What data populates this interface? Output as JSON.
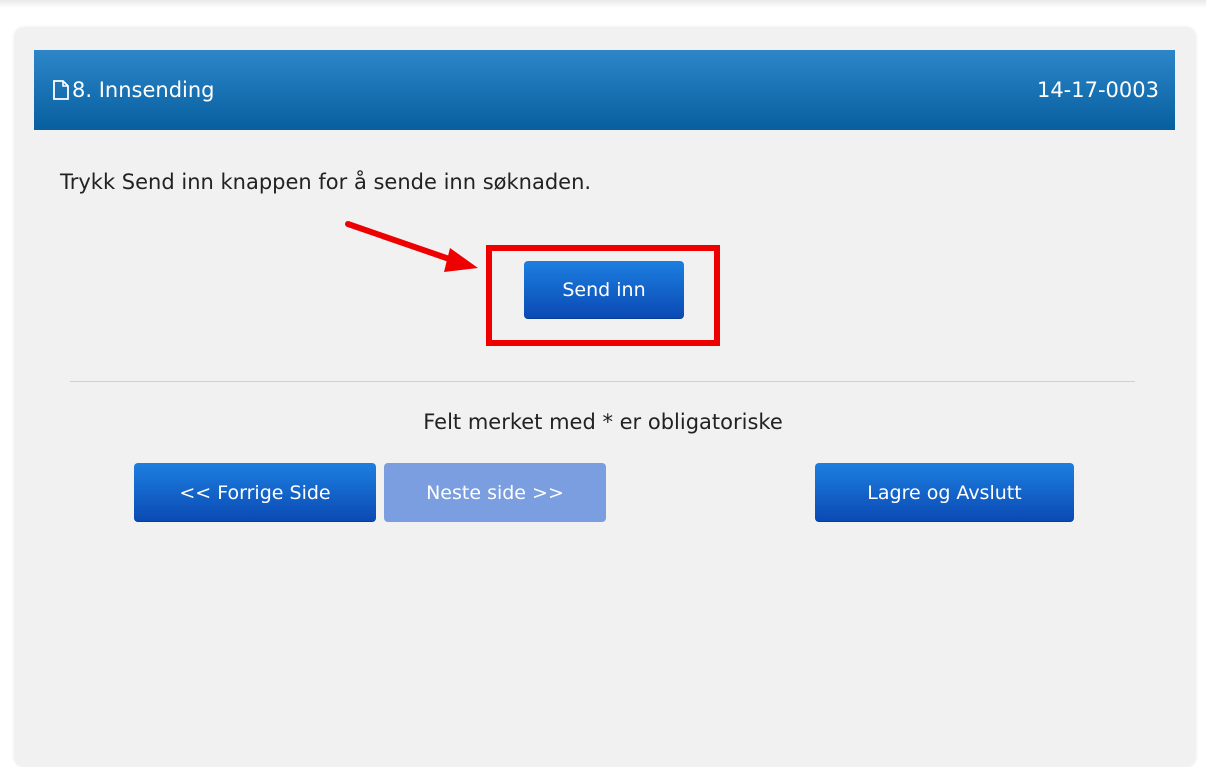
{
  "header": {
    "title": "8. Innsending",
    "reference": "14-17-0003",
    "icon": "document-icon"
  },
  "main": {
    "instruction": "Trykk Send inn knappen for å sende inn søknaden.",
    "send_button_label": "Send inn",
    "required_note": "Felt merket med * er obligatoriske"
  },
  "navigation": {
    "prev_label": "<< Forrige Side",
    "next_label": "Neste side >>",
    "save_label": "Lagre og Avslutt",
    "next_enabled": false
  },
  "annotation": {
    "highlight_color": "#ee0000",
    "target": "send-inn-button"
  },
  "colors": {
    "header_top": "#2c86c8",
    "header_bottom": "#075f9f",
    "button_top": "#1d7fe0",
    "button_bottom": "#0a49b3",
    "button_disabled": "#7a9ee0",
    "panel_background": "#f1f1f1"
  }
}
